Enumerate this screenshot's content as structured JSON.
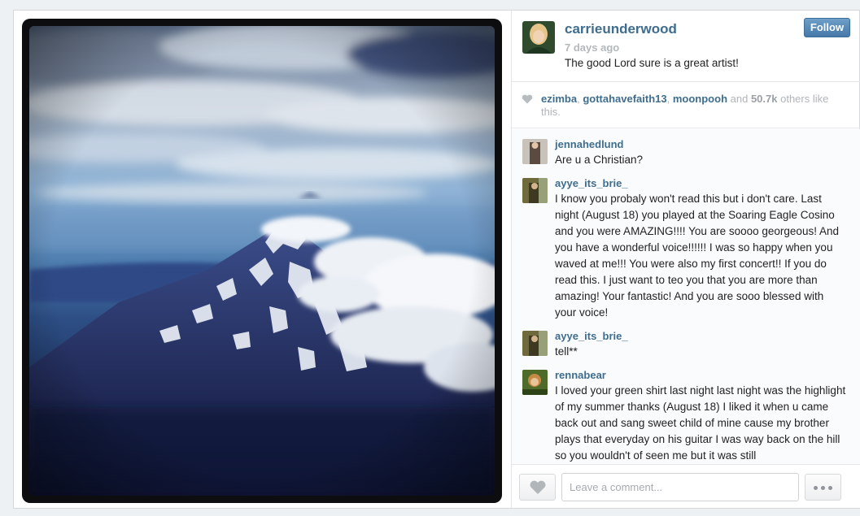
{
  "post": {
    "username": "carrieunderwood",
    "time_ago": "7 days ago",
    "caption": "The good Lord sure is a great artist!",
    "follow_label": "Follow"
  },
  "likes": {
    "users": [
      "ezimba",
      "gottahavefaith13",
      "moonpooh"
    ],
    "separator": ", ",
    "and_text": " and ",
    "count": "50.7k",
    "suffix": " others like this."
  },
  "comments": [
    {
      "user": "jennahedlund",
      "text": "Are u a Christian?",
      "avatar_color": "#8a7468"
    },
    {
      "user": "ayye_its_brie_",
      "text": "I know you probaly won't read this but i don't care. Last night (August 18) you played at the Soaring Eagle Cosino and you were AMAZING!!!! You are soooo georgeous! And you have a wonderful voice!!!!!! I was so happy when you waved at me!!! You were also my first concert!! If you do read this. I just want to teo you that you are more than amazing! Your fantastic! And you are sooo blessed with your voice!",
      "avatar_color": "#6f6a3c"
    },
    {
      "user": "ayye_its_brie_",
      "text": "tell**",
      "avatar_color": "#6f6a3c"
    },
    {
      "user": "rennabear",
      "text": "I loved your green shirt last night last night was the highlight of my summer thanks (August 18) I liked it when u came back out and sang sweet child of mine cause my brother plays that everyday on his guitar I was way back on the hill so you wouldn't of seen me but it was still",
      "avatar_color": "#7a5a2a"
    }
  ],
  "comment_box": {
    "placeholder": "Leave a comment..."
  },
  "colors": {
    "link": "#3e6d8e",
    "follow_button": "#5587b8",
    "muted": "#b3b8bd"
  },
  "icons": {
    "like": "heart-icon",
    "more": "ellipsis-icon"
  }
}
